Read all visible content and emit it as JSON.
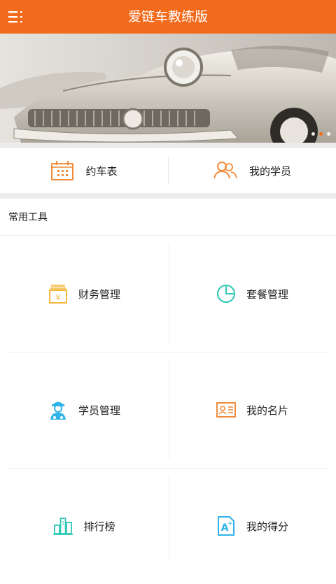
{
  "header": {
    "title": "爱链车教练版",
    "menu_icon": "menu-icon"
  },
  "banner": {
    "slides": 3,
    "active_slide": 1
  },
  "quick_actions": [
    {
      "label": "约车表",
      "icon": "calendar-icon",
      "color": "#f28c3d"
    },
    {
      "label": "我的学员",
      "icon": "students-icon",
      "color": "#f28c3d"
    }
  ],
  "tools": {
    "title": "常用工具",
    "items": [
      {
        "label": "财务管理",
        "icon": "finance-icon",
        "color": "#f5b73b"
      },
      {
        "label": "套餐管理",
        "icon": "package-pie-icon",
        "color": "#2fc9b5"
      },
      {
        "label": "学员管理",
        "icon": "student-management-icon",
        "color": "#2fb3e8"
      },
      {
        "label": "我的名片",
        "icon": "business-card-icon",
        "color": "#f28c3d"
      },
      {
        "label": "排行榜",
        "icon": "ranking-icon",
        "color": "#2fc9b5"
      },
      {
        "label": "我的得分",
        "icon": "score-icon",
        "color": "#2fb3e8"
      }
    ]
  },
  "colors": {
    "accent": "#f26a1b",
    "separator": "#ececec"
  }
}
